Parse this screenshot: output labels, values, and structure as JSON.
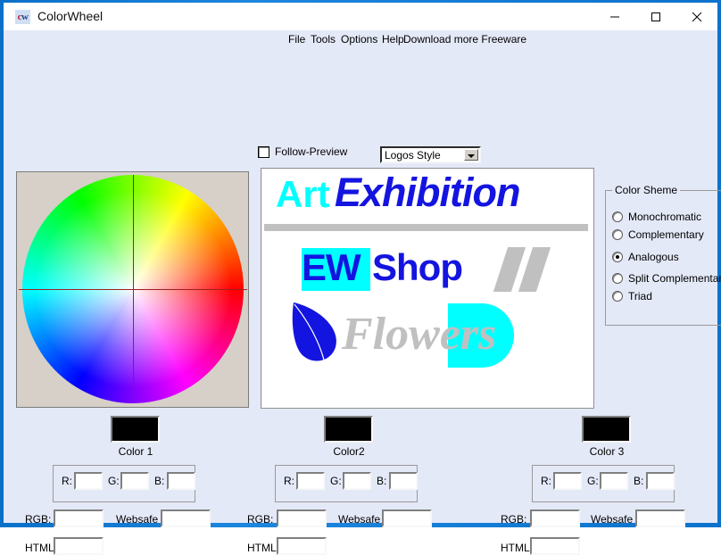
{
  "window": {
    "title": "ColorWheel",
    "icon_text_c": "c",
    "icon_text_w": "w",
    "icon_name": "colorwheel-app-icon",
    "controls": {
      "minimize": "minimize",
      "maximize": "maximize",
      "close": "close"
    },
    "frame_color": "#0f79d0",
    "client_bg": "#e4e9f8"
  },
  "menu": {
    "items": [
      {
        "label": "File"
      },
      {
        "label": "Tools"
      },
      {
        "label": "Options"
      },
      {
        "label": "Help"
      },
      {
        "label": "Download more Freeware"
      }
    ]
  },
  "toolbar": {
    "follow_preview_label": "Follow-Preview",
    "follow_preview_checked": false,
    "style_dropdown_value": "Logos Style",
    "style_dropdown_options": [
      "Logos Style"
    ]
  },
  "color_wheel": {
    "name": "color-wheel",
    "panel_bg": "#d6d0c8",
    "crosshair_color": "#a02020",
    "selected_hue_position": "center"
  },
  "preview": {
    "bg": "#ffffff",
    "logo1": {
      "word1": "Art",
      "word1_color": "#00ffff",
      "word2": "Exhibition",
      "word2_color": "#1414e0",
      "bar_color": "#c0c0c0"
    },
    "logo2": {
      "word1": "EW",
      "word1_color": "#1414e0",
      "word1_bg": "#00ffff",
      "word2": "Shop",
      "word2_color": "#1414e0",
      "slash_color": "#c0c0c0"
    },
    "logo3": {
      "word": "Flowers",
      "word_color": "#c0c0c0",
      "leaf_color": "#1414e0",
      "fan_color": "#00ffff"
    }
  },
  "color_scheme": {
    "title": "Color Sheme",
    "options": [
      {
        "label": "Monochromatic",
        "selected": false
      },
      {
        "label": "Complementary",
        "selected": false
      },
      {
        "label": "Analogous",
        "selected": true
      },
      {
        "label": "Split Complementary",
        "selected": false
      },
      {
        "label": "Triad",
        "selected": false
      }
    ]
  },
  "colors": [
    {
      "swatch_label": "Color 1",
      "swatch_color": "#000000",
      "r_label": "R:",
      "r_value": "",
      "g_label": "G:",
      "g_value": "",
      "b_label": "B:",
      "b_value": "",
      "rgb_label": "RGB:",
      "rgb_value": "",
      "websafe_label": "Websafe",
      "websafe_value": "",
      "html_label": "HTML",
      "html_value": ""
    },
    {
      "swatch_label": "Color2",
      "swatch_color": "#000000",
      "r_label": "R:",
      "r_value": "",
      "g_label": "G:",
      "g_value": "",
      "b_label": "B:",
      "b_value": "",
      "rgb_label": "RGB:",
      "rgb_value": "",
      "websafe_label": "Websafe",
      "websafe_value": "",
      "html_label": "HTML",
      "html_value": ""
    },
    {
      "swatch_label": "Color 3",
      "swatch_color": "#000000",
      "r_label": "R:",
      "r_value": "",
      "g_label": "G:",
      "g_value": "",
      "b_label": "B:",
      "b_value": "",
      "rgb_label": "RGB:",
      "rgb_value": "",
      "websafe_label": "Websafe",
      "websafe_value": "",
      "html_label": "HTML",
      "html_value": ""
    }
  ]
}
